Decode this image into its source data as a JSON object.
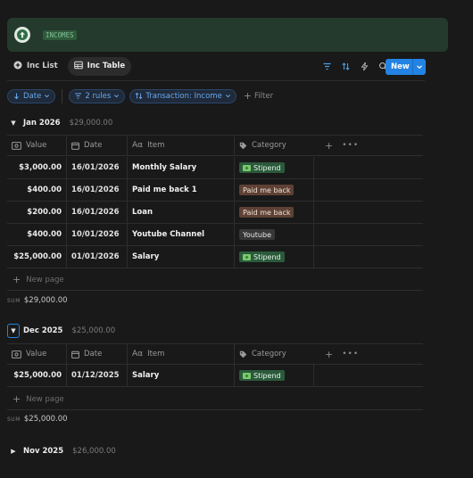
{
  "callout": {
    "tag": "INCOMES",
    "icon": "arrow-up-circle-icon"
  },
  "tabs": [
    {
      "label": "Inc List",
      "icon": "plus-circle-icon",
      "active": false
    },
    {
      "label": "Inc Table",
      "icon": "table-icon",
      "active": true
    }
  ],
  "toolbar": {
    "new_label": "New"
  },
  "filters": {
    "sort": "Date",
    "rules": "2 rules",
    "property": "Transaction: Income",
    "add": "Filter"
  },
  "columns": [
    "Value",
    "Date",
    "Item",
    "Category"
  ],
  "groups": [
    {
      "name": "Jan 2026",
      "sum": "$29,000.00",
      "rows": [
        {
          "value": "$3,000.00",
          "date": "16/01/2026",
          "item": "Monthly Salary",
          "category": "Stipend",
          "cat_style": "green",
          "cat_icon": "money-icon"
        },
        {
          "value": "$400.00",
          "date": "16/01/2026",
          "item": "Paid me back 1",
          "category": "Paid me back",
          "cat_style": "brown",
          "cat_icon": ""
        },
        {
          "value": "$200.00",
          "date": "16/01/2026",
          "item": "Loan",
          "category": "Paid me back",
          "cat_style": "brown",
          "cat_icon": ""
        },
        {
          "value": "$400.00",
          "date": "10/01/2026",
          "item": "Youtube Channel",
          "category": "Youtube",
          "cat_style": "gray",
          "cat_icon": ""
        },
        {
          "value": "$25,000.00",
          "date": "01/01/2026",
          "item": "Salary",
          "category": "Stipend",
          "cat_style": "green",
          "cat_icon": "money-icon"
        }
      ],
      "new_page": "New page",
      "sum_label": "SUM",
      "sum_value": "$29,000.00"
    },
    {
      "name": "Dec 2025",
      "sum": "$25,000.00",
      "rows": [
        {
          "value": "$25,000.00",
          "date": "01/12/2025",
          "item": "Salary",
          "category": "Stipend",
          "cat_style": "green",
          "cat_icon": "money-icon"
        }
      ],
      "new_page": "New page",
      "sum_label": "SUM",
      "sum_value": "$25,000.00"
    },
    {
      "name": "Nov 2025",
      "sum": "$26,000.00",
      "rows": []
    }
  ]
}
